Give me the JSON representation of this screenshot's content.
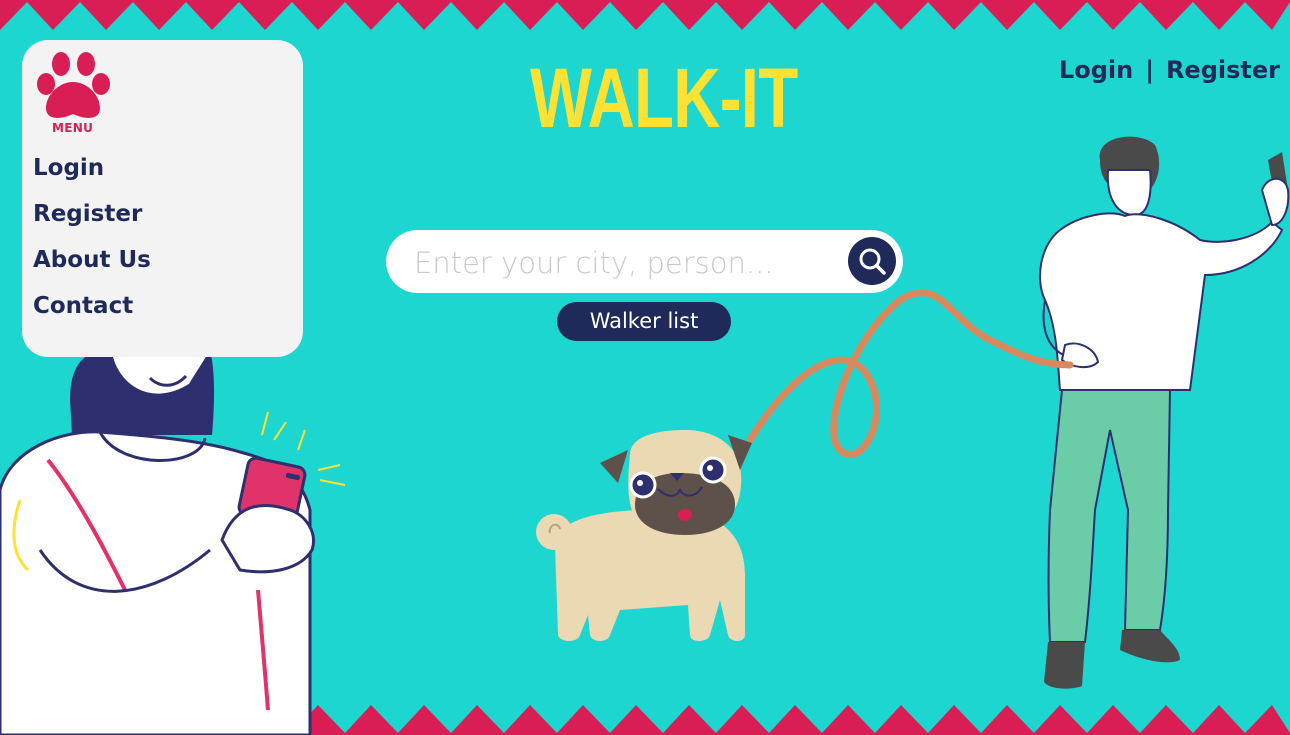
{
  "brand": {
    "title": "WALK-IT",
    "color": "#fde233"
  },
  "header": {
    "login_label": "Login",
    "separator": "|",
    "register_label": "Register"
  },
  "menu": {
    "caption": "MENU",
    "icon": "paw-icon",
    "items": [
      {
        "label": "Login"
      },
      {
        "label": "Register"
      },
      {
        "label": "About Us"
      },
      {
        "label": "Contact"
      }
    ]
  },
  "search": {
    "placeholder": "Enter your city, person...",
    "value": "",
    "icon": "search-icon"
  },
  "walker_list_button": {
    "label": "Walker list"
  },
  "illustrations": [
    "woman-with-phone-illustration",
    "pug-illustration",
    "leash-illustration",
    "man-with-phone-illustration"
  ],
  "colors": {
    "background": "#1ed6d0",
    "accent": "#d81e55",
    "navy": "#1f2a5a",
    "panel": "#f4f3f4"
  }
}
